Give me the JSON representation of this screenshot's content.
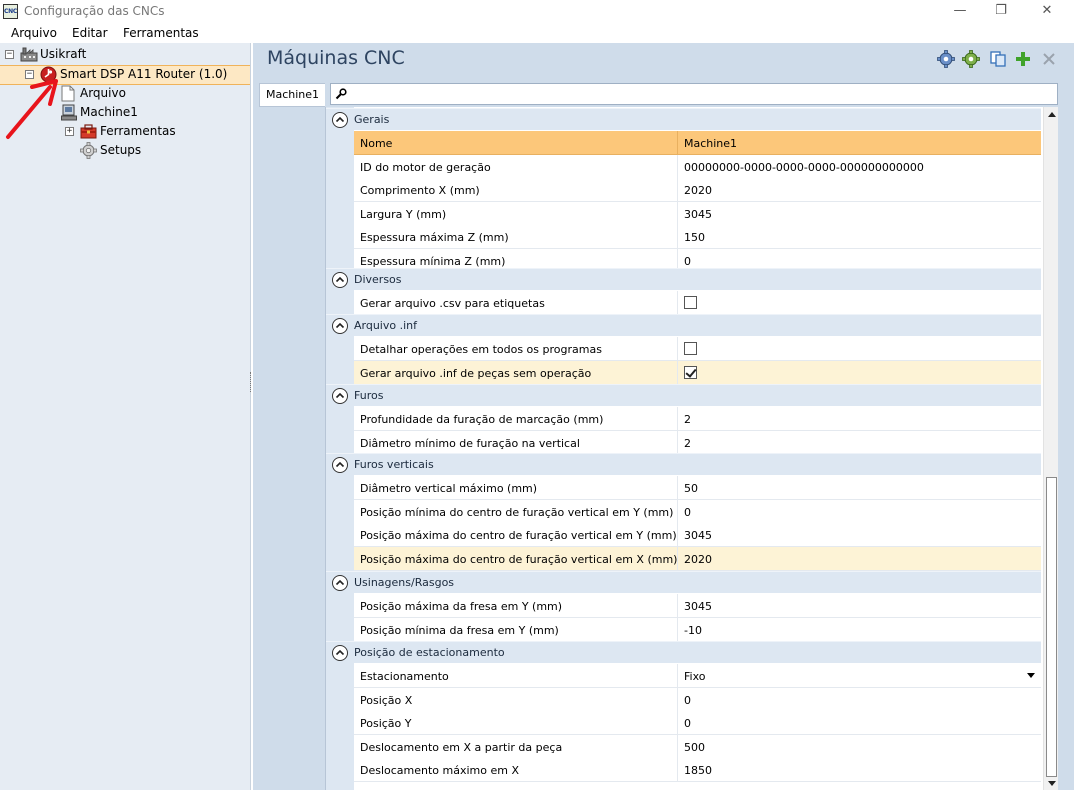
{
  "window": {
    "app_icon_text": "CNC",
    "title": "Configuração das CNCs",
    "minimize": "—",
    "maximize": "❐",
    "close": "✕"
  },
  "menu": [
    "Arquivo",
    "Editar",
    "Ferramentas"
  ],
  "tree": {
    "root": "Usikraft",
    "machine_type": "Smart DSP A11 Router (1.0)",
    "arquivo": "Arquivo",
    "machine": "Machine1",
    "ferramentas": "Ferramentas",
    "setups": "Setups"
  },
  "main": {
    "title": "Máquinas CNC",
    "tab": "Machine1",
    "search_value": ""
  },
  "groups": [
    {
      "label": "Gerais",
      "rows": [
        {
          "name": "Nome",
          "value": "Machine1",
          "kind": "header"
        },
        {
          "name": "ID do motor de geração",
          "value": "00000000-0000-0000-0000-000000000000"
        },
        {
          "name": "Comprimento X (mm)",
          "value": "2020"
        },
        {
          "name": "Largura Y (mm)",
          "value": "3045"
        },
        {
          "name": "Espessura máxima Z (mm)",
          "value": "150"
        },
        {
          "name": "Espessura mínima Z (mm)",
          "value": "0"
        }
      ]
    },
    {
      "label": "Diversos",
      "rows": [
        {
          "name": "Gerar arquivo .csv para etiquetas",
          "checked": false,
          "kind": "checkbox"
        }
      ]
    },
    {
      "label": "Arquivo .inf",
      "rows": [
        {
          "name": "Detalhar operações em todos os programas",
          "checked": false,
          "kind": "checkbox"
        },
        {
          "name": "Gerar arquivo .inf de peças sem operação",
          "checked": true,
          "kind": "checkbox",
          "highlight": true
        }
      ]
    },
    {
      "label": "Furos",
      "rows": [
        {
          "name": "Profundidade da furação de marcação (mm)",
          "value": "2"
        },
        {
          "name": "Diâmetro mínimo de furação na vertical",
          "value": "2"
        }
      ]
    },
    {
      "label": "Furos verticais",
      "rows": [
        {
          "name": "Diâmetro vertical máximo (mm)",
          "value": "50"
        },
        {
          "name": "Posição mínima do centro de furação vertical em Y (mm)",
          "value": "0"
        },
        {
          "name": "Posição máxima do centro de furação vertical em Y (mm)",
          "value": "3045"
        },
        {
          "name": "Posição máxima do centro de furação vertical em X (mm)",
          "value": "2020",
          "highlight": true
        }
      ]
    },
    {
      "label": "Usinagens/Rasgos",
      "rows": [
        {
          "name": "Posição máxima da fresa em Y (mm)",
          "value": "3045"
        },
        {
          "name": "Posição mínima da fresa em Y (mm)",
          "value": "-10"
        }
      ]
    },
    {
      "label": "Posição de estacionamento",
      "rows": [
        {
          "name": "Estacionamento",
          "value": "Fixo",
          "kind": "dropdown"
        },
        {
          "name": "Posição X",
          "value": "0"
        },
        {
          "name": "Posição Y",
          "value": "0"
        },
        {
          "name": "Deslocamento em X a partir da peça",
          "value": "500"
        },
        {
          "name": "Deslocamento máximo em X",
          "value": "1850"
        }
      ]
    }
  ],
  "colors": {
    "accent_header": "#fcc77a",
    "highlight_row": "#fdf3d6",
    "tree_selection": "#fde8c4",
    "panel_bg": "#cfdcea",
    "annotation_arrow": "#e8141b"
  }
}
